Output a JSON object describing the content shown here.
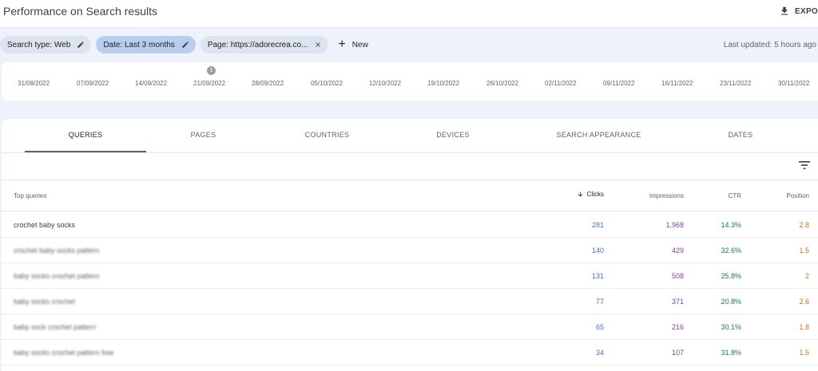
{
  "header": {
    "title": "Performance on Search results",
    "export_label": "EXPO"
  },
  "filters": {
    "chips": [
      {
        "label": "Search type: Web",
        "active": false
      },
      {
        "label": "Date: Last 3 months",
        "active": true
      },
      {
        "label": "Page: https://adorecrea.co...",
        "active": false
      }
    ],
    "new_label": "New",
    "last_updated": "Last updated: 5 hours ago"
  },
  "timeline": {
    "marker": "1",
    "dates": [
      "31/08/2022",
      "07/09/2022",
      "14/09/2022",
      "21/09/2022",
      "28/09/2022",
      "05/10/2022",
      "12/10/2022",
      "19/10/2022",
      "26/10/2022",
      "02/11/2022",
      "09/11/2022",
      "16/11/2022",
      "23/11/2022",
      "30/11/2022"
    ]
  },
  "tabs": [
    "QUERIES",
    "PAGES",
    "COUNTRIES",
    "DEVICES",
    "SEARCH APPEARANCE",
    "DATES"
  ],
  "table": {
    "headers": {
      "query": "Top queries",
      "clicks": "Clicks",
      "impressions": "Impressions",
      "ctr": "CTR",
      "position": "Position"
    },
    "rows": [
      {
        "query": "crochet baby socks",
        "clicks": "281",
        "impressions": "1,968",
        "ctr": "14.3%",
        "position": "2.8",
        "blurred": false
      },
      {
        "query": "crochet baby socks pattern",
        "clicks": "140",
        "impressions": "429",
        "ctr": "32.6%",
        "position": "1.5",
        "blurred": true
      },
      {
        "query": "baby socks crochet pattern",
        "clicks": "131",
        "impressions": "508",
        "ctr": "25.8%",
        "position": "2",
        "blurred": true
      },
      {
        "query": "baby socks crochet",
        "clicks": "77",
        "impressions": "371",
        "ctr": "20.8%",
        "position": "2.6",
        "blurred": true
      },
      {
        "query": "baby sock crochet pattern",
        "clicks": "65",
        "impressions": "216",
        "ctr": "30.1%",
        "position": "1.8",
        "blurred": true
      },
      {
        "query": "baby socks crochet pattern free",
        "clicks": "34",
        "impressions": "107",
        "ctr": "31.8%",
        "position": "1.5",
        "blurred": true
      }
    ]
  },
  "colors": {
    "clicks": "#4470c4",
    "impressions": "#7b3fa8",
    "ctr": "#188038",
    "position": "#d56e0c",
    "active_chip": "#b9cdef"
  },
  "icons": {
    "export": "download-icon",
    "edit": "pencil-icon",
    "close": "close-icon",
    "add": "plus-icon",
    "filter": "filter-list-icon",
    "sort": "arrow-down-icon"
  }
}
